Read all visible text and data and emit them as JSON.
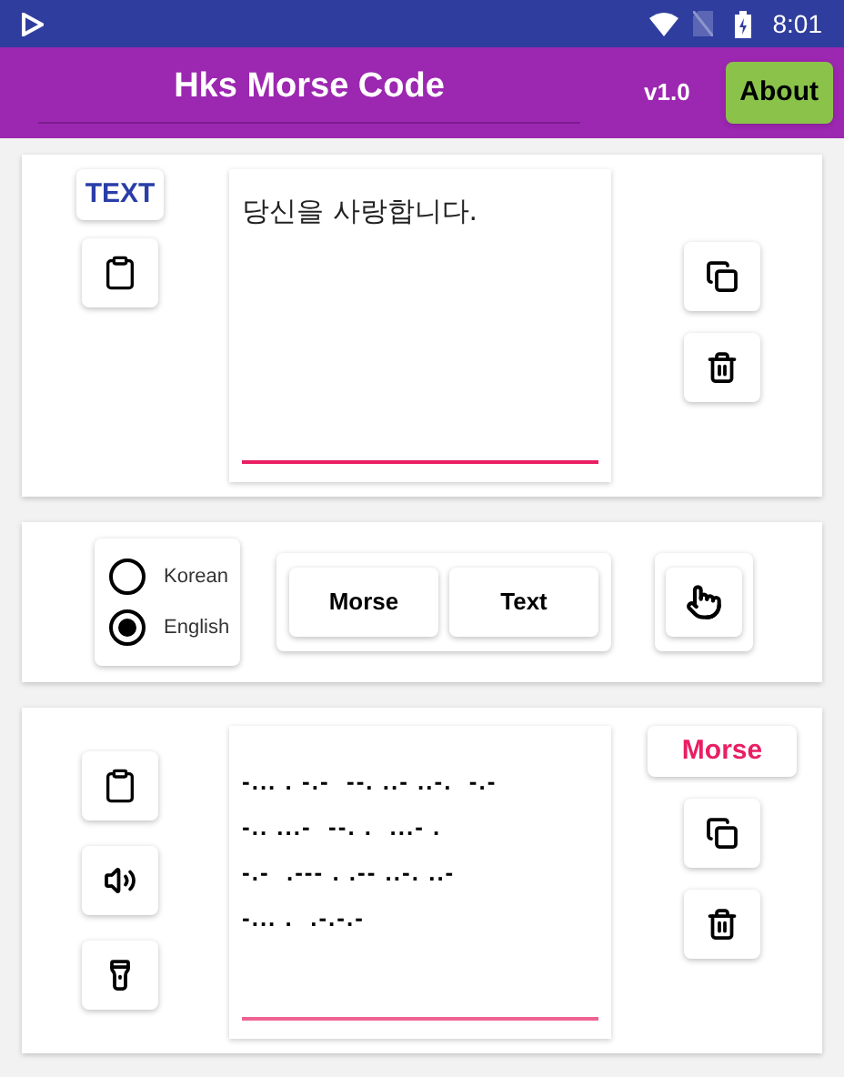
{
  "status_bar": {
    "time": "8:01"
  },
  "app_bar": {
    "title": "Hks Morse Code",
    "version": "v1.0",
    "about_button": "About"
  },
  "text_panel": {
    "mode_label": "TEXT",
    "input": "당신을 사랑합니다."
  },
  "language": [
    {
      "label": "Korean",
      "selected": false
    },
    {
      "label": "English",
      "selected": true
    }
  ],
  "convert_buttons": [
    "Morse",
    "Text"
  ],
  "morse_panel": {
    "mode_label": "Morse",
    "lines": [
      "-... . -.-  --. ..- ..-.  -.-",
      "-.. ...-  --. .  ...- .",
      "-.-  .--- . .-- ..-. ..-",
      "-... .  .-.-.-"
    ]
  }
}
